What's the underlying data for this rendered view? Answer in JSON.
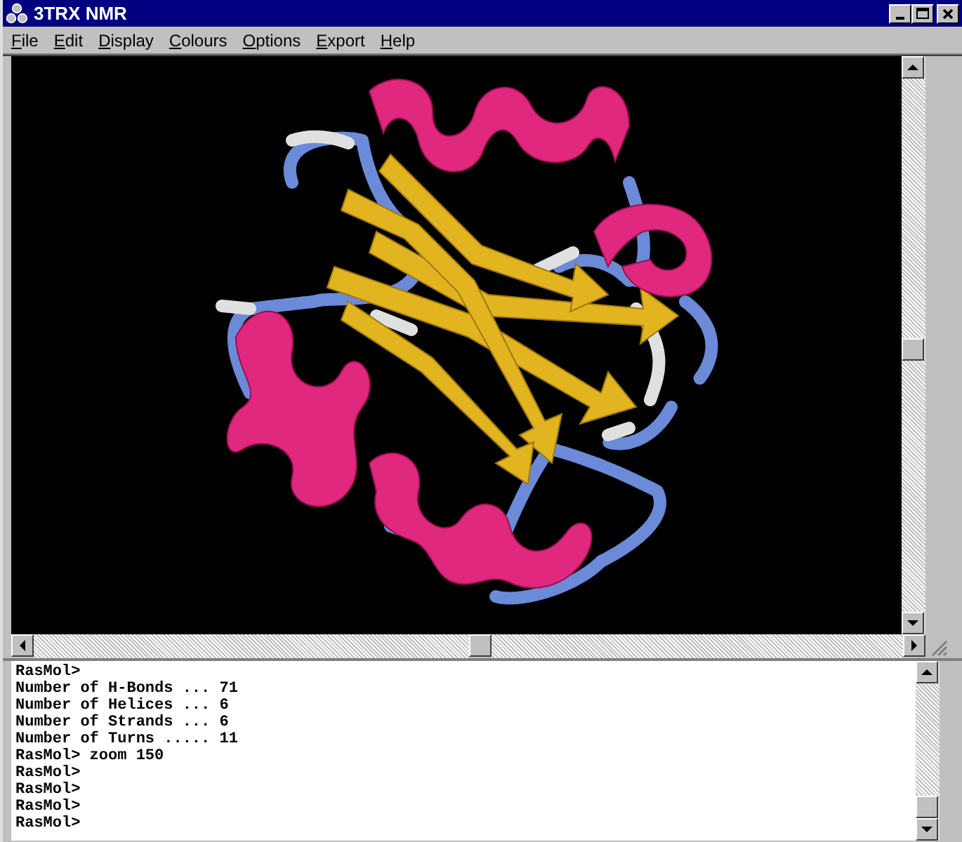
{
  "window": {
    "title": "3TRX NMR"
  },
  "menu": [
    {
      "label": "File"
    },
    {
      "label": "Edit"
    },
    {
      "label": "Display"
    },
    {
      "label": "Colours"
    },
    {
      "label": "Options"
    },
    {
      "label": "Export"
    },
    {
      "label": "Help"
    }
  ],
  "console": {
    "lines": [
      "RasMol>",
      "Number of H-Bonds ... 71",
      "Number of Helices ... 6",
      "Number of Strands ... 6",
      "Number of Turns ..... 11",
      "RasMol> zoom 150",
      "RasMol>",
      "RasMol>",
      "RasMol>",
      "RasMol>"
    ]
  }
}
